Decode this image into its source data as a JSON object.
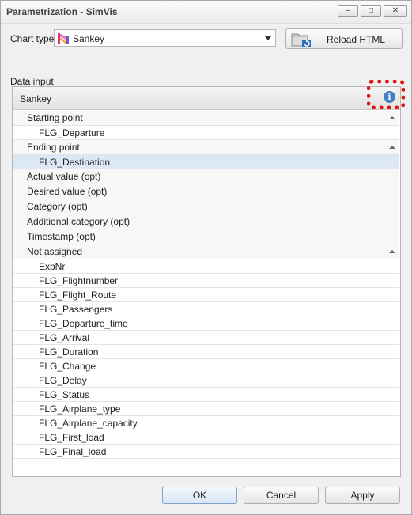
{
  "window": {
    "title": "Parametrization - SimVis"
  },
  "chart_type": {
    "label": "Chart type",
    "value": "Sankey"
  },
  "reload_button": {
    "label": "Reload HTML"
  },
  "data_input": {
    "label": "Data input",
    "group_title": "Sankey",
    "sections": [
      {
        "label": "Starting point",
        "collapsible": true,
        "items": [
          "FLG_Departure"
        ]
      },
      {
        "label": "Ending point",
        "collapsible": true,
        "items": [
          "FLG_Destination"
        ],
        "selected_item": "FLG_Destination"
      },
      {
        "label": "Actual value (opt)",
        "collapsible": false,
        "items": []
      },
      {
        "label": "Desired value (opt)",
        "collapsible": false,
        "items": []
      },
      {
        "label": "Category (opt)",
        "collapsible": false,
        "items": []
      },
      {
        "label": "Additional category (opt)",
        "collapsible": false,
        "items": []
      },
      {
        "label": "Timestamp (opt)",
        "collapsible": false,
        "items": []
      },
      {
        "label": "Not assigned",
        "collapsible": true,
        "items": [
          "ExpNr",
          "FLG_Flightnumber",
          "FLG_Flight_Route",
          "FLG_Passengers",
          "FLG_Departure_time",
          "FLG_Arrival",
          "FLG_Duration",
          "FLG_Change",
          "FLG_Delay",
          "FLG_Status",
          "FLG_Airplane_type",
          "FLG_Airplane_capacity",
          "FLG_First_load",
          "FLG_Final_load"
        ]
      }
    ]
  },
  "buttons": {
    "ok": "OK",
    "cancel": "Cancel",
    "apply": "Apply"
  },
  "icons": {
    "info": "info-icon",
    "sankey": "sankey-chart-icon",
    "reload": "folder-reload-icon"
  },
  "colors": {
    "info": "#3f7fc4",
    "highlight": "#e01010",
    "selected_row": "#dde8f7"
  }
}
